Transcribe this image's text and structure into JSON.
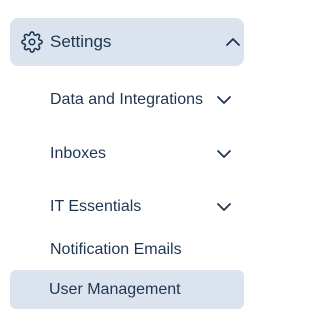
{
  "nav": {
    "settings": {
      "label": "Settings",
      "icon": "gear-icon",
      "expanded": true
    },
    "items": [
      {
        "label": "Data and Integrations",
        "has_children": true,
        "chevron_icon": "chevron-down-icon"
      },
      {
        "label": "Inboxes",
        "has_children": true,
        "chevron_icon": "chevron-down-icon"
      },
      {
        "label": "IT Essentials",
        "has_children": true,
        "chevron_icon": "chevron-down-icon"
      },
      {
        "label": "Notification Emails",
        "has_children": false
      },
      {
        "label": "User Management",
        "has_children": false,
        "selected": true
      }
    ]
  },
  "colors": {
    "text": "#1f3551",
    "highlight_bg": "#dbe3ef",
    "background": "#ffffff"
  }
}
